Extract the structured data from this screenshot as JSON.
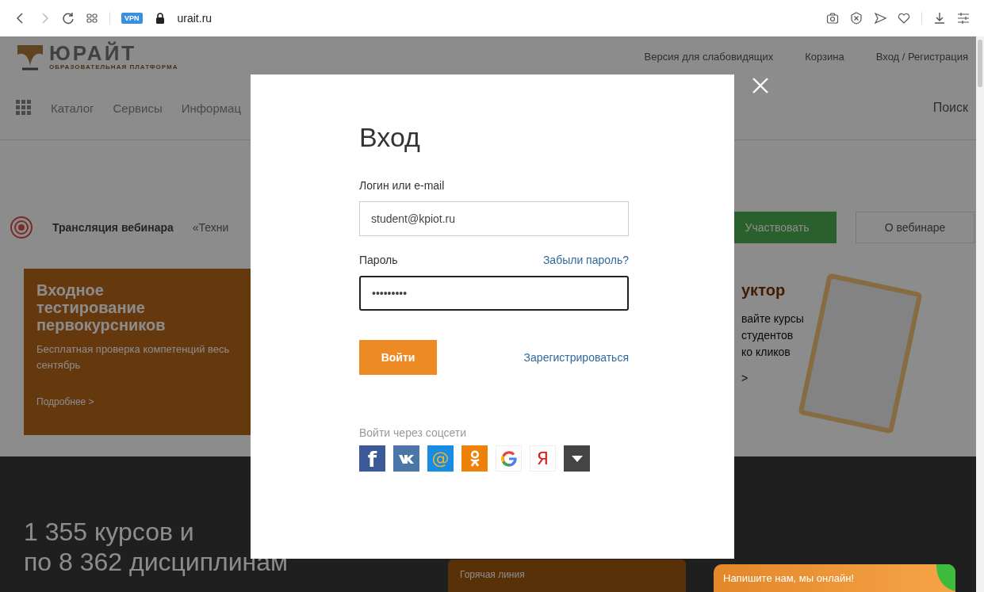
{
  "browser": {
    "vpn_badge": "VPN",
    "url": "urait.ru"
  },
  "site_header": {
    "logo_title": "ЮРАЙТ",
    "logo_subtitle": "ОБРАЗОВАТЕЛЬНАЯ ПЛАТФОРМА",
    "links": [
      "Версия для слабовидящих",
      "Корзина",
      "Вход / Регистрация"
    ]
  },
  "nav": {
    "items": [
      "Каталог",
      "Сервисы",
      "Информац"
    ],
    "search": "Поиск"
  },
  "webinar": {
    "label": "Трансляция вебинара",
    "title": "«Техни",
    "buttons": [
      "Участвовать",
      "О вебинаре"
    ]
  },
  "banners": [
    {
      "title": "Входное тестирование первокурсников",
      "text": "Бесплатная проверка компетенций весь сентябрь",
      "link": "Подробнее >"
    },
    {
      "title": "уктор",
      "text_lines": [
        "вайте курсы",
        "студентов",
        "ко кликов"
      ],
      "link": ">"
    }
  ],
  "hero": {
    "lines": [
      "1 355 курсов и",
      "по 8 362 дисциплинам"
    ],
    "hotline": "Горячая линия"
  },
  "chat": {
    "label": "Напишите нам, мы онлайн!"
  },
  "login_dialog": {
    "title": "Вход",
    "login_label": "Логин или e-mail",
    "login_value": "student@kpiot.ru",
    "password_label": "Пароль",
    "forgot_link": "Забыли пароль?",
    "password_value": "•••••••••",
    "password_focused": true,
    "submit": "Войти",
    "register_link": "Зарегистрироваться",
    "social_label": "Войти через соцсети",
    "socials": [
      {
        "kind": "facebook",
        "glyph": "f"
      },
      {
        "kind": "vk"
      },
      {
        "kind": "mail",
        "glyph": "@"
      },
      {
        "kind": "ok"
      },
      {
        "kind": "google"
      },
      {
        "kind": "yandex",
        "glyph": "Я"
      },
      {
        "kind": "more"
      }
    ]
  }
}
